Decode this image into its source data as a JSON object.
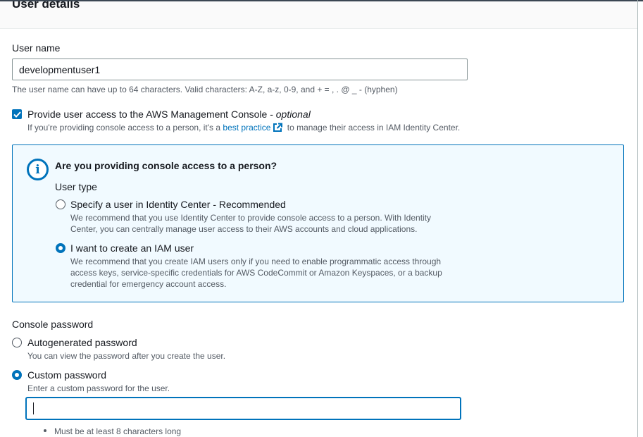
{
  "section": {
    "title": "User details"
  },
  "username": {
    "label": "User name",
    "value": "developmentuser1",
    "hint": "The user name can have up to 64 characters. Valid characters: A-Z, a-z, 0-9, and + = , . @ _ - (hyphen)"
  },
  "console_access": {
    "checked": true,
    "label": "Provide user access to the AWS Management Console - ",
    "label_optional": "optional",
    "hint_before": "If you're providing console access to a person, it's a ",
    "hint_link": "best practice",
    "hint_after": " to manage their access in IAM Identity Center."
  },
  "info_box": {
    "icon": "info-icon",
    "title": "Are you providing console access to a person?",
    "user_type_label": "User type",
    "options": [
      {
        "label": "Specify a user in Identity Center - Recommended",
        "desc1": "We recommend that you use Identity Center to provide console access to a person. With Identity",
        "desc2": "Center, you can centrally manage user access to their AWS accounts and cloud applications.",
        "selected": false
      },
      {
        "label": "I want to create an IAM user",
        "desc1": "We recommend that you create IAM users only if you need to enable programmatic access through",
        "desc2": "access keys, service-specific credentials for AWS CodeCommit or Amazon Keyspaces, or a backup",
        "desc3": "credential for emergency account access.",
        "selected": true
      }
    ]
  },
  "console_password": {
    "label": "Console password",
    "options": [
      {
        "label": "Autogenerated password",
        "desc": "You can view the password after you create the user.",
        "selected": false
      },
      {
        "label": "Custom password",
        "desc": "Enter a custom password for the user.",
        "selected": true
      }
    ],
    "value": "",
    "requirements": [
      "Must be at least 8 characters long"
    ]
  },
  "colors": {
    "accent": "#0073bb",
    "info_bg": "#f1faff",
    "text": "#16191f",
    "hint": "#545b64"
  }
}
